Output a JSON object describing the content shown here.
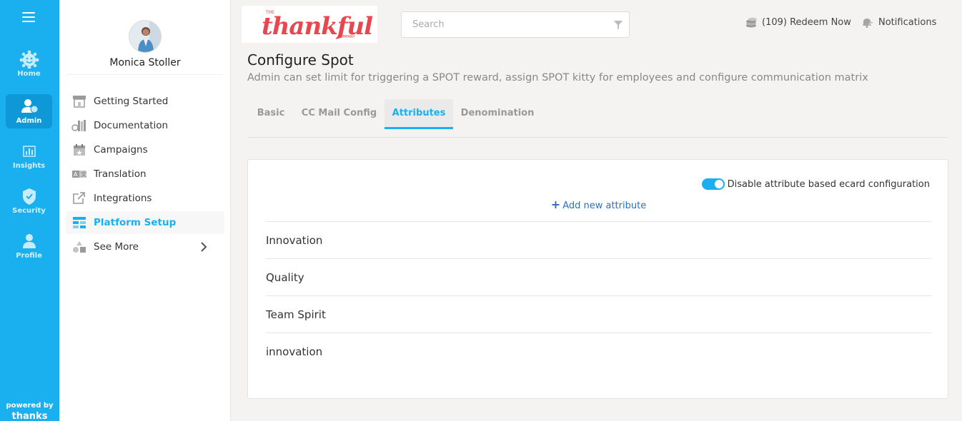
{
  "rail": {
    "items": [
      {
        "label": "Home",
        "icon": "home-icon"
      },
      {
        "label": "Admin",
        "icon": "admin-icon"
      },
      {
        "label": "Insights",
        "icon": "insights-icon"
      },
      {
        "label": "Security",
        "icon": "shield-icon"
      },
      {
        "label": "Profile",
        "icon": "profile-icon"
      }
    ],
    "powered_by": "powered by",
    "brand": "thanks"
  },
  "user": {
    "name": "Monica Stoller"
  },
  "sidebar": {
    "items": [
      {
        "label": "Getting Started",
        "icon": "store-icon"
      },
      {
        "label": "Documentation",
        "icon": "documentation-icon"
      },
      {
        "label": "Campaigns",
        "icon": "calendar-icon"
      },
      {
        "label": "Translation",
        "icon": "translate-icon"
      },
      {
        "label": "Integrations",
        "icon": "external-link-icon"
      },
      {
        "label": "Platform Setup",
        "icon": "platform-setup-icon"
      },
      {
        "label": "See More",
        "icon": "shapes-icon"
      }
    ]
  },
  "header": {
    "logo_prefix": "THE",
    "logo_text": "thankful",
    "logo_suffix": "COMPANY",
    "search_placeholder": "Search",
    "redeem_label": "(109) Redeem Now",
    "notifications_label": "Notifications"
  },
  "page": {
    "title": "Configure Spot",
    "subtitle": "Admin can set limit for triggering a SPOT reward, assign SPOT kitty for employees and configure communication matrix"
  },
  "tabs": [
    {
      "label": "Basic"
    },
    {
      "label": "CC Mail Config"
    },
    {
      "label": "Attributes"
    },
    {
      "label": "Denomination"
    }
  ],
  "attributes": {
    "toggle_label": "Disable attribute based ecard configuration",
    "toggle_on": true,
    "add_label": "Add new attribute",
    "items": [
      "Innovation",
      "Quality",
      "Team Spirit",
      "innovation"
    ]
  },
  "colors": {
    "accent": "#1ab0f0",
    "logo": "#e8474f",
    "link": "#2a6fbf"
  }
}
